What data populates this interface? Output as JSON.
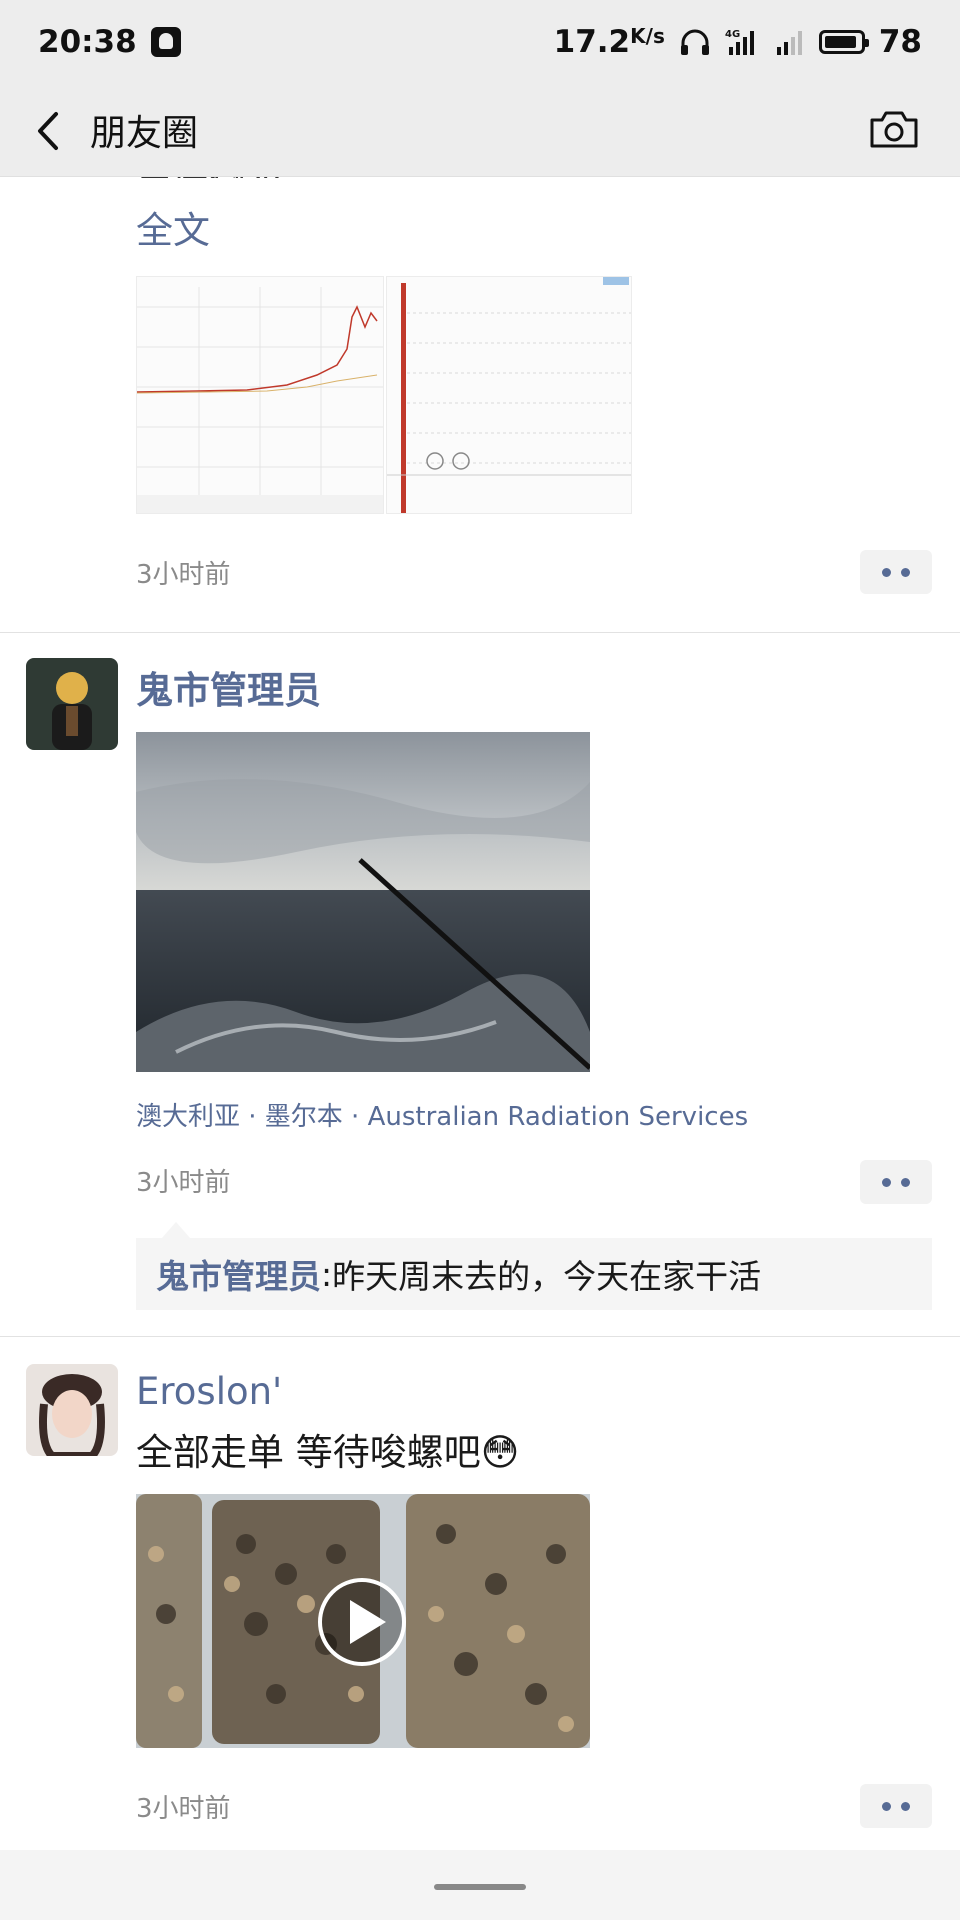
{
  "status_bar": {
    "time": "20:38",
    "speed": "17.2",
    "speed_unit": "K/s",
    "battery": "78"
  },
  "nav": {
    "title": "朋友圈"
  },
  "post1": {
    "full_text_label": "全文",
    "partial_text": "王庄微步",
    "timestamp": "3小时前"
  },
  "post2": {
    "username": "鬼市管理员",
    "location": "澳大利亚 · 墨尔本 · Australian Radiation Services",
    "timestamp": "3小时前",
    "comment": {
      "author": "鬼市管理员",
      "separator": ": ",
      "text": "昨天周末去的，今天在家干活"
    }
  },
  "post3": {
    "username": "Eroslon'",
    "text": "全部走单 等待唆螺吧😳",
    "timestamp": "3小时前"
  },
  "colors": {
    "link": "#576b95",
    "nav_bg": "#ededed"
  }
}
